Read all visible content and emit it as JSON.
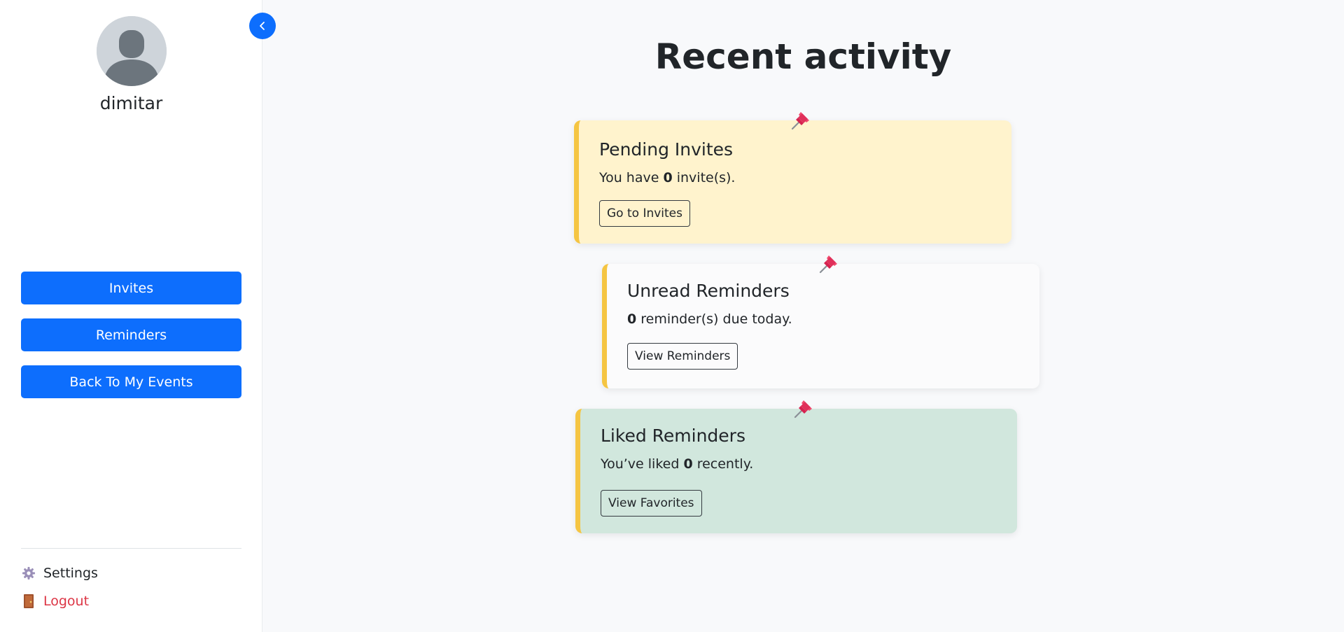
{
  "sidebar": {
    "username": "dimitar",
    "buttons": {
      "invites": "Invites",
      "reminders": "Reminders",
      "back": "Back To My Events"
    },
    "footer": {
      "settings_icon": "gear-icon",
      "settings": "Settings",
      "logout_icon": "door-icon",
      "logout": "Logout"
    }
  },
  "colors": {
    "primary": "#0d6efd",
    "danger": "#dc3545",
    "accent_border": "#f5c542",
    "card_invites_bg": "#fff3cd",
    "card_reminders_bg": "#fbfbfc",
    "card_liked_bg": "#d1e7dd"
  },
  "main": {
    "title": "Recent activity",
    "cards": [
      {
        "title": "Pending Invites",
        "text_before": "You have ",
        "count": "0",
        "text_after": " invite(s).",
        "button": "Go to Invites",
        "icon": "pushpin-icon"
      },
      {
        "title": "Unread Reminders",
        "text_before": "",
        "count": "0",
        "text_after": " reminder(s) due today.",
        "button": "View Reminders",
        "icon": "pushpin-icon"
      },
      {
        "title": "Liked Reminders",
        "text_before": "You’ve liked ",
        "count": "0",
        "text_after": " recently.",
        "button": "View Favorites",
        "icon": "pushpin-icon"
      }
    ]
  }
}
